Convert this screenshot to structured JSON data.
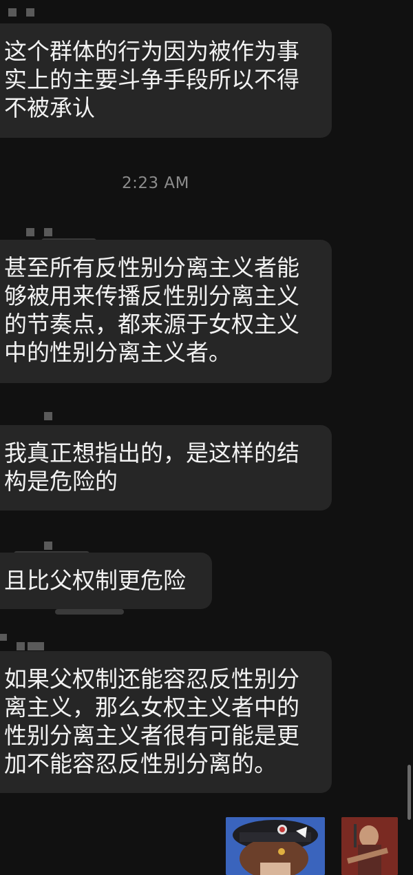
{
  "messages": [
    {
      "lines": [
        "这个群体的行为因为被作为事",
        "实上的主要斗争手段所以不得",
        "不被承认"
      ]
    },
    {
      "lines": [
        "甚至所有反性别分离主义者能",
        "够被用来传播反性别分离主义",
        "的节奏点，都来源于女权主义",
        "中的性别分离主义者。"
      ]
    },
    {
      "lines": [
        "我真正想指出的，是这样的结",
        "构是危险的"
      ]
    },
    {
      "lines": [
        "且比父权制更危险"
      ]
    },
    {
      "lines": [
        "如果父权制还能容忍反性别分",
        "离主义，那么女权主义者中的",
        "性别分离主义者很有可能是更",
        "加不能容忍反性别分离的。"
      ]
    }
  ],
  "timestamp": "2:23 AM",
  "colors": {
    "background": "#111111",
    "bubble": "#262626",
    "text": "#f2f2f2",
    "timestamp": "#8c8c8c"
  }
}
